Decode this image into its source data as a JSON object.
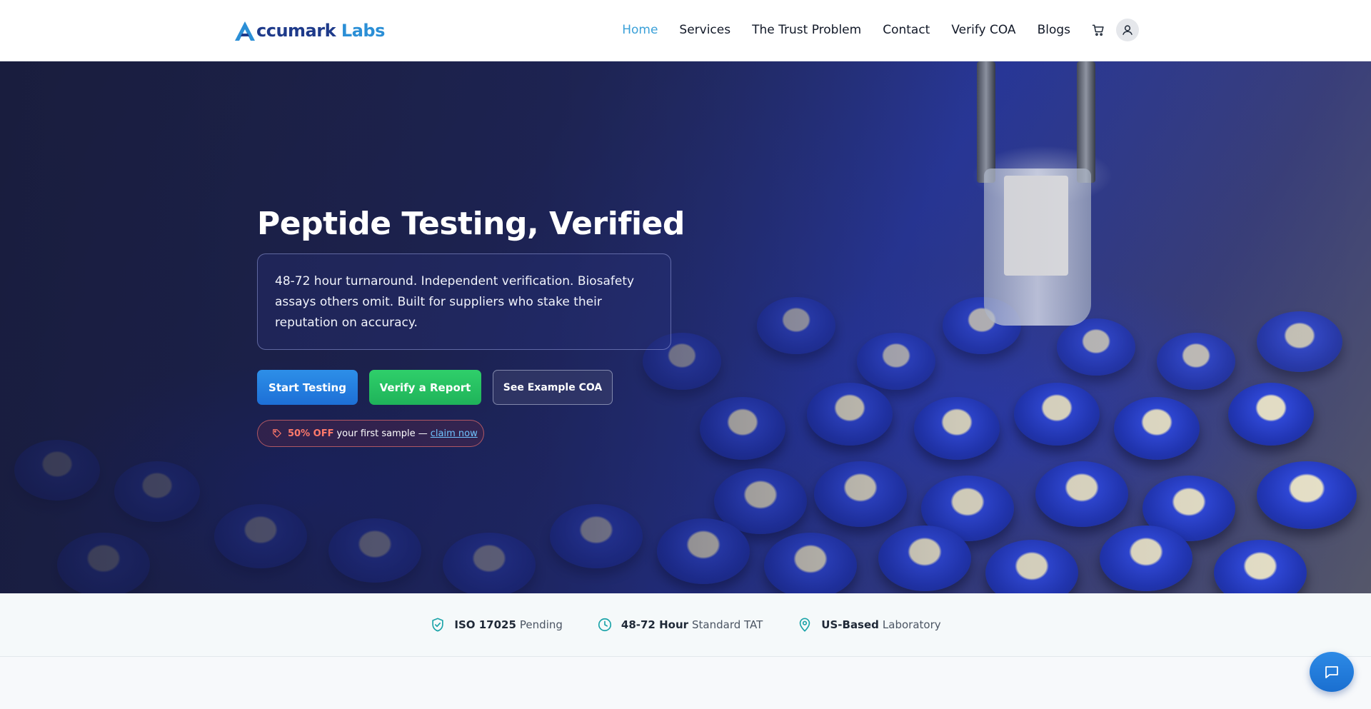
{
  "brand": {
    "logo_prefix": "A",
    "logo_main": "ccumark",
    "logo_suffix": "Labs"
  },
  "nav": {
    "items": [
      "Home",
      "Services",
      "The Trust Problem",
      "Contact",
      "Verify COA",
      "Blogs"
    ],
    "active": "Home",
    "icons": [
      "cart-icon",
      "user-icon"
    ]
  },
  "hero": {
    "title": "Peptide Testing, Verified",
    "description": "48-72 hour turnaround. Independent verification. Biosafety assays others omit. Built for suppliers who stake their reputation on accuracy.",
    "buttons": {
      "start": "Start Testing",
      "verify": "Verify a Report",
      "example": "See Example COA"
    },
    "promo": {
      "discount": "50% OFF",
      "text": "your first sample —",
      "link": "claim now"
    }
  },
  "trust": [
    {
      "icon": "shield-check-icon",
      "strong": "ISO 17025",
      "light": "Pending"
    },
    {
      "icon": "clock-icon",
      "strong": "48-72 Hour",
      "light": "Standard TAT"
    },
    {
      "icon": "location-pin-icon",
      "strong": "US-Based",
      "light": "Laboratory"
    }
  ],
  "colors": {
    "accent": "#3aa0d8",
    "start_button": "#1d6fd6",
    "verify_button": "#1fb35a",
    "promo_highlight": "#ff7a6b",
    "trust_icon": "#1aa3a8"
  }
}
